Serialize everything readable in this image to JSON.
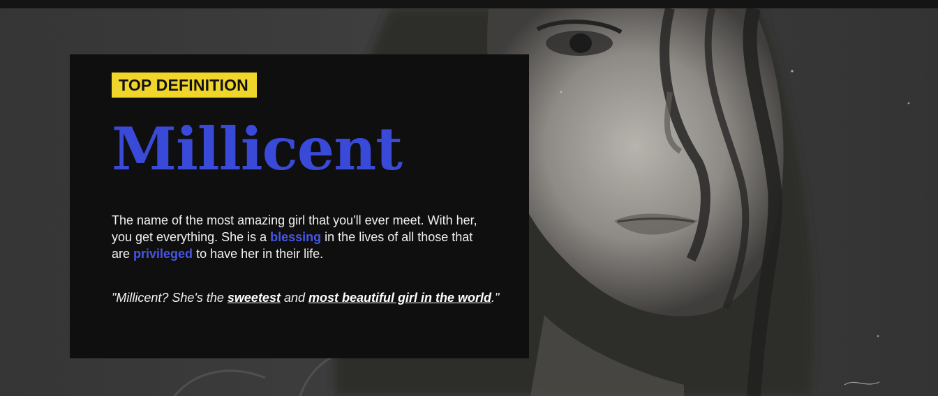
{
  "badge": {
    "label": "TOP DEFINITION"
  },
  "entry": {
    "word": "Millicent",
    "meaning": {
      "part1": "The name of the most amazing girl that you'll ever meet. With her, you get everything. She is a ",
      "link1": "blessing",
      "part2": " in the lives of all those that are ",
      "link2": "privileged",
      "part3": " to have her in their life."
    },
    "example": {
      "part1": "\"Millicent? She's the ",
      "link1": "sweetest",
      "part2": " and ",
      "link2": "most beautiful girl in the world",
      "part3": ".\""
    }
  },
  "colors": {
    "accent": "#3a4ad8",
    "badge_bg": "#f0d52a",
    "card_bg": "#0f0f0f"
  }
}
